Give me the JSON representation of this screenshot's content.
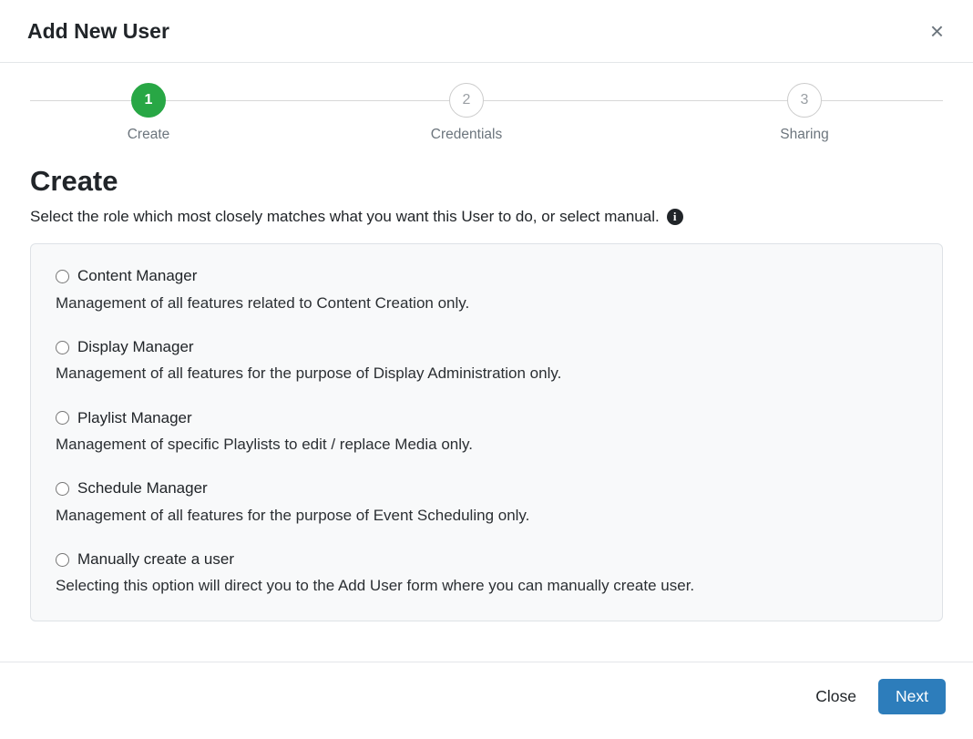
{
  "modal": {
    "title": "Add New User",
    "close_icon": "×"
  },
  "stepper": {
    "steps": [
      {
        "number": "1",
        "label": "Create",
        "state": "active"
      },
      {
        "number": "2",
        "label": "Credentials",
        "state": "upcoming"
      },
      {
        "number": "3",
        "label": "Sharing",
        "state": "upcoming"
      }
    ]
  },
  "content": {
    "heading": "Create",
    "subtitle": "Select the role which most closely matches what you want this User to do, or select manual.",
    "info_icon": "i",
    "options": [
      {
        "label": "Content Manager",
        "description": "Management of all features related to Content Creation only.",
        "selected": false
      },
      {
        "label": "Display Manager",
        "description": "Management of all features for the purpose of Display Administration only.",
        "selected": false
      },
      {
        "label": "Playlist Manager",
        "description": "Management of specific Playlists to edit / replace Media only.",
        "selected": false
      },
      {
        "label": "Schedule Manager",
        "description": "Management of all features for the purpose of Event Scheduling only.",
        "selected": false
      },
      {
        "label": "Manually create a user",
        "description": "Selecting this option will direct you to the Add User form where you can manually create user.",
        "selected": false
      }
    ]
  },
  "footer": {
    "close_label": "Close",
    "next_label": "Next"
  },
  "colors": {
    "accent_green": "#28a745",
    "primary_blue": "#2d7dbb",
    "panel_bg": "#f8f9fa",
    "border": "#dee2e6"
  }
}
